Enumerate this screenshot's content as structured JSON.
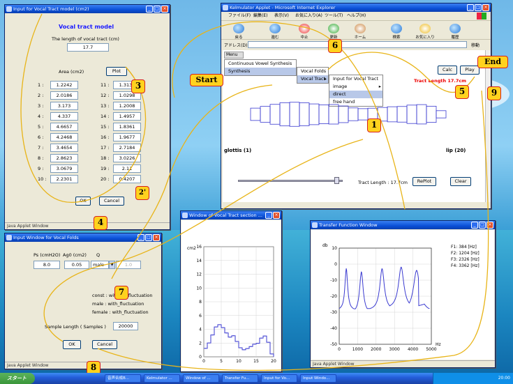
{
  "vocal_tract_window": {
    "title": "Input for Vocal Tract model  (cm2)",
    "heading": "Vocal tract model",
    "length_label": "The length of vocal tract (cm)",
    "length_value": "17.7",
    "area_label": "Area (cm2)",
    "plot_label": "Plot",
    "areas_left": [
      {
        "n": "1 :",
        "v": "1.2242"
      },
      {
        "n": "2 :",
        "v": "2.0186"
      },
      {
        "n": "3 :",
        "v": "3.173"
      },
      {
        "n": "4 :",
        "v": "4.337"
      },
      {
        "n": "5 :",
        "v": "4.6657"
      },
      {
        "n": "6 :",
        "v": "4.2468"
      },
      {
        "n": "7 :",
        "v": "3.4654"
      },
      {
        "n": "8 :",
        "v": "2.8623"
      },
      {
        "n": "9 :",
        "v": "3.0679"
      },
      {
        "n": "10 :",
        "v": "2.2301"
      }
    ],
    "areas_right": [
      {
        "n": "11 :",
        "v": "1.3138"
      },
      {
        "n": "12 :",
        "v": "1.0298"
      },
      {
        "n": "13 :",
        "v": "1.2008"
      },
      {
        "n": "14 :",
        "v": "1.4957"
      },
      {
        "n": "15 :",
        "v": "1.8361"
      },
      {
        "n": "16 :",
        "v": "1.9677"
      },
      {
        "n": "17 :",
        "v": "2.7184"
      },
      {
        "n": "18 :",
        "v": "3.0226"
      },
      {
        "n": "19 :",
        "v": "2.11"
      },
      {
        "n": "20 :",
        "v": "0.4207"
      }
    ],
    "ok_label": "OK",
    "cancel_label": "Cancel",
    "status": "Java Applet Window"
  },
  "ie_window": {
    "title": "Kelmulator Applet - Microsoft Internet Explorer",
    "menus": [
      "ファイル(F)",
      "編集(E)",
      "表示(V)",
      "お気に入り(A)",
      "ツール(T)",
      "ヘルプ(H)"
    ],
    "toolbar": [
      "戻る",
      "進む",
      "中止",
      "更新",
      "ホーム",
      "検索",
      "お気に入り",
      "履歴"
    ],
    "address_label": "アドレス(D)",
    "go_label": "移動",
    "menu_label": "Menu",
    "menu_items": [
      "Continuous Vowel Synthesis",
      "Synthesis"
    ],
    "sub_items": [
      "Vocal Folds",
      "Vocal Tract"
    ],
    "sub2_items": [
      "Input for Vocal Tract",
      "image",
      "direct",
      "free hand"
    ],
    "calc_label": "Calc",
    "play_label": "Play",
    "tract_length_label": "Tract Length 17.7cm",
    "glottis_label": "glottis (1)",
    "lip_label": "lip (20)",
    "slider_readout": "Tract Length : 17.7cm",
    "replot_label": "RePlot",
    "clear_label": "Clear"
  },
  "vocal_folds_window": {
    "title": "Input Window for Vocal Folds",
    "ps_label": "Ps (cmH2O)",
    "ag0_label": "Ag0 (cm2)",
    "q_label": "Q",
    "ps_value": "8.0",
    "ag0_value": "0.05",
    "q_select": "male",
    "q_value": "1.0",
    "notes": [
      "const : without_fluctuation",
      "male : with_fluctuation",
      "female : with_fluctuation"
    ],
    "sample_label": "Sample Length ( Samples )",
    "sample_value": "20000",
    "ok_label": "OK",
    "cancel_label": "Cancel",
    "status": "Java Applet Window"
  },
  "area_window": {
    "title": "Window of Vocal Tract section ...",
    "ylabel": "cm2",
    "status": ""
  },
  "transfer_window": {
    "title": "Transfer Function Window",
    "ylabel": "db",
    "xlabel": "Hz",
    "formants": [
      "F1: 384 [Hz]",
      "F2: 1204 [Hz]",
      "F3: 2326 [Hz]",
      "F4: 3362 [Hz]"
    ],
    "status": "Java Applet Window"
  },
  "chart_data": [
    {
      "type": "line",
      "title": "",
      "ylabel": "cm2",
      "xlabel": "",
      "xlim": [
        0,
        20
      ],
      "ylim": [
        0,
        16
      ],
      "x_ticks": [
        0,
        5,
        10,
        15,
        20
      ],
      "y_ticks": [
        0,
        2,
        4,
        6,
        8,
        10,
        12,
        14,
        16
      ],
      "step": true,
      "x": [
        1,
        2,
        3,
        4,
        5,
        6,
        7,
        8,
        9,
        10,
        11,
        12,
        13,
        14,
        15,
        16,
        17,
        18,
        19,
        20
      ],
      "values": [
        1.2242,
        2.0186,
        3.173,
        4.337,
        4.6657,
        4.2468,
        3.4654,
        2.8623,
        3.0679,
        2.2301,
        1.3138,
        1.0298,
        1.2008,
        1.4957,
        1.8361,
        1.9677,
        2.7184,
        3.0226,
        2.11,
        0.4207
      ]
    },
    {
      "type": "line",
      "title": "",
      "ylabel": "db",
      "xlabel": "Hz",
      "xlim": [
        0,
        5000
      ],
      "ylim": [
        -50,
        10
      ],
      "x_ticks": [
        0,
        1000,
        2000,
        3000,
        4000,
        5000
      ],
      "y_ticks": [
        10,
        0,
        -10,
        -20,
        -30,
        -40,
        -50
      ],
      "formants_hz": [
        384,
        1204,
        2326,
        3362,
        4200
      ],
      "peaks_db": [
        -3,
        -5,
        -3,
        -2,
        -4
      ],
      "tail_db": -26
    }
  ],
  "callouts": [
    "1",
    "2'",
    "3",
    "4",
    "5",
    "6",
    "7",
    "8",
    "9",
    "Start",
    "End"
  ],
  "taskbar": {
    "start_label": "スタート",
    "tasks": [
      "音声合成B...",
      "Kelmulator ...",
      "Window of ...",
      "Transfer Fu...",
      "Input for Vo...",
      "Input Windo..."
    ],
    "clock": "20:00"
  },
  "colors": {
    "accent": "#1a1aff",
    "title_bar": "#0a4fd6",
    "close": "#e2512c",
    "tract_box": "#3a3ad0",
    "callout_fill": "#ffd21e",
    "callout_border": "#d62020"
  }
}
